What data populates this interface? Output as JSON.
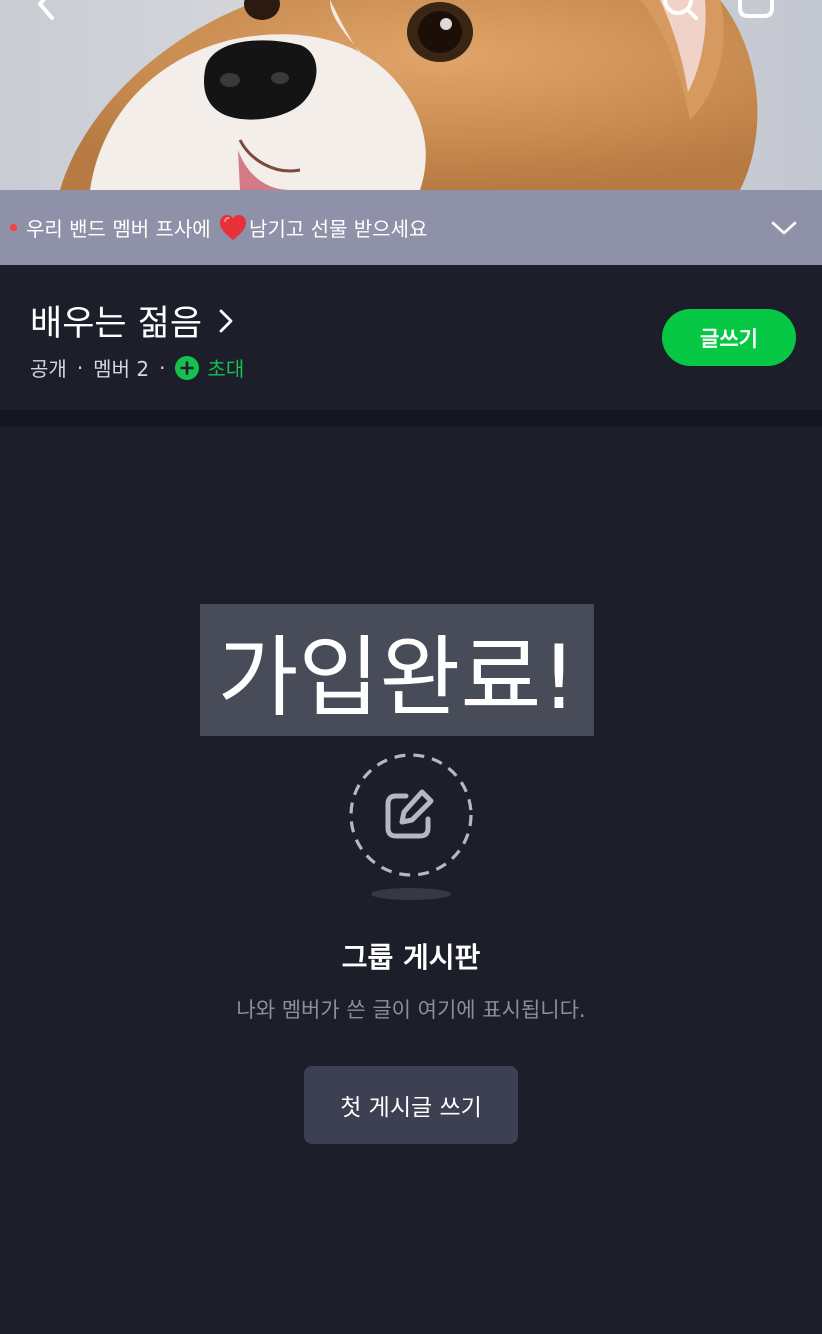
{
  "cover": {
    "icons": {
      "back": "chevron-left-icon",
      "search": "search-icon",
      "menu": "menu-icon"
    }
  },
  "notice": {
    "text_before": "우리 밴드 멤버 프사에",
    "text_after": "남기고 선물 받으세요",
    "heart_icon": "heart-icon",
    "chevron_icon": "chevron-down-icon",
    "dot_color": "#f04438"
  },
  "band": {
    "name": "배우는 젊음",
    "visibility": "공개",
    "members": "멤버 2",
    "invite_label": "초대",
    "write_label": "글쓰기"
  },
  "toast": {
    "text": "가입완료!"
  },
  "empty_state": {
    "icon": "edit-icon",
    "title": "그룹 게시판",
    "description": "나와 멤버가 쓴 글이 여기에 표시됩니다.",
    "button_label": "첫 게시글 쓰기"
  },
  "colors": {
    "accent": "#07c845",
    "background": "#1c1e2a",
    "notice_bar": "#8e91a8"
  }
}
